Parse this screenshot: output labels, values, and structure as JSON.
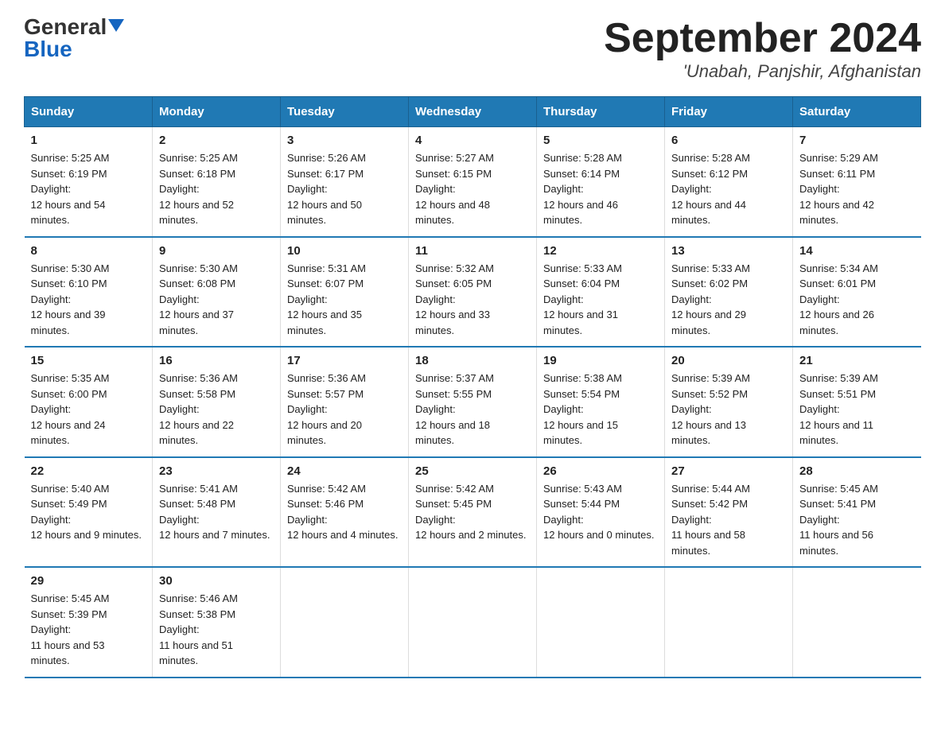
{
  "logo": {
    "general": "General",
    "blue": "Blue"
  },
  "title": {
    "main": "September 2024",
    "sub": "'Unabah, Panjshir, Afghanistan"
  },
  "headers": [
    "Sunday",
    "Monday",
    "Tuesday",
    "Wednesday",
    "Thursday",
    "Friday",
    "Saturday"
  ],
  "weeks": [
    [
      {
        "day": "1",
        "sunrise": "5:25 AM",
        "sunset": "6:19 PM",
        "daylight": "12 hours and 54 minutes."
      },
      {
        "day": "2",
        "sunrise": "5:25 AM",
        "sunset": "6:18 PM",
        "daylight": "12 hours and 52 minutes."
      },
      {
        "day": "3",
        "sunrise": "5:26 AM",
        "sunset": "6:17 PM",
        "daylight": "12 hours and 50 minutes."
      },
      {
        "day": "4",
        "sunrise": "5:27 AM",
        "sunset": "6:15 PM",
        "daylight": "12 hours and 48 minutes."
      },
      {
        "day": "5",
        "sunrise": "5:28 AM",
        "sunset": "6:14 PM",
        "daylight": "12 hours and 46 minutes."
      },
      {
        "day": "6",
        "sunrise": "5:28 AM",
        "sunset": "6:12 PM",
        "daylight": "12 hours and 44 minutes."
      },
      {
        "day": "7",
        "sunrise": "5:29 AM",
        "sunset": "6:11 PM",
        "daylight": "12 hours and 42 minutes."
      }
    ],
    [
      {
        "day": "8",
        "sunrise": "5:30 AM",
        "sunset": "6:10 PM",
        "daylight": "12 hours and 39 minutes."
      },
      {
        "day": "9",
        "sunrise": "5:30 AM",
        "sunset": "6:08 PM",
        "daylight": "12 hours and 37 minutes."
      },
      {
        "day": "10",
        "sunrise": "5:31 AM",
        "sunset": "6:07 PM",
        "daylight": "12 hours and 35 minutes."
      },
      {
        "day": "11",
        "sunrise": "5:32 AM",
        "sunset": "6:05 PM",
        "daylight": "12 hours and 33 minutes."
      },
      {
        "day": "12",
        "sunrise": "5:33 AM",
        "sunset": "6:04 PM",
        "daylight": "12 hours and 31 minutes."
      },
      {
        "day": "13",
        "sunrise": "5:33 AM",
        "sunset": "6:02 PM",
        "daylight": "12 hours and 29 minutes."
      },
      {
        "day": "14",
        "sunrise": "5:34 AM",
        "sunset": "6:01 PM",
        "daylight": "12 hours and 26 minutes."
      }
    ],
    [
      {
        "day": "15",
        "sunrise": "5:35 AM",
        "sunset": "6:00 PM",
        "daylight": "12 hours and 24 minutes."
      },
      {
        "day": "16",
        "sunrise": "5:36 AM",
        "sunset": "5:58 PM",
        "daylight": "12 hours and 22 minutes."
      },
      {
        "day": "17",
        "sunrise": "5:36 AM",
        "sunset": "5:57 PM",
        "daylight": "12 hours and 20 minutes."
      },
      {
        "day": "18",
        "sunrise": "5:37 AM",
        "sunset": "5:55 PM",
        "daylight": "12 hours and 18 minutes."
      },
      {
        "day": "19",
        "sunrise": "5:38 AM",
        "sunset": "5:54 PM",
        "daylight": "12 hours and 15 minutes."
      },
      {
        "day": "20",
        "sunrise": "5:39 AM",
        "sunset": "5:52 PM",
        "daylight": "12 hours and 13 minutes."
      },
      {
        "day": "21",
        "sunrise": "5:39 AM",
        "sunset": "5:51 PM",
        "daylight": "12 hours and 11 minutes."
      }
    ],
    [
      {
        "day": "22",
        "sunrise": "5:40 AM",
        "sunset": "5:49 PM",
        "daylight": "12 hours and 9 minutes."
      },
      {
        "day": "23",
        "sunrise": "5:41 AM",
        "sunset": "5:48 PM",
        "daylight": "12 hours and 7 minutes."
      },
      {
        "day": "24",
        "sunrise": "5:42 AM",
        "sunset": "5:46 PM",
        "daylight": "12 hours and 4 minutes."
      },
      {
        "day": "25",
        "sunrise": "5:42 AM",
        "sunset": "5:45 PM",
        "daylight": "12 hours and 2 minutes."
      },
      {
        "day": "26",
        "sunrise": "5:43 AM",
        "sunset": "5:44 PM",
        "daylight": "12 hours and 0 minutes."
      },
      {
        "day": "27",
        "sunrise": "5:44 AM",
        "sunset": "5:42 PM",
        "daylight": "11 hours and 58 minutes."
      },
      {
        "day": "28",
        "sunrise": "5:45 AM",
        "sunset": "5:41 PM",
        "daylight": "11 hours and 56 minutes."
      }
    ],
    [
      {
        "day": "29",
        "sunrise": "5:45 AM",
        "sunset": "5:39 PM",
        "daylight": "11 hours and 53 minutes."
      },
      {
        "day": "30",
        "sunrise": "5:46 AM",
        "sunset": "5:38 PM",
        "daylight": "11 hours and 51 minutes."
      },
      null,
      null,
      null,
      null,
      null
    ]
  ],
  "labels": {
    "sunrise_prefix": "Sunrise: ",
    "sunset_prefix": "Sunset: ",
    "daylight_prefix": "Daylight: "
  }
}
